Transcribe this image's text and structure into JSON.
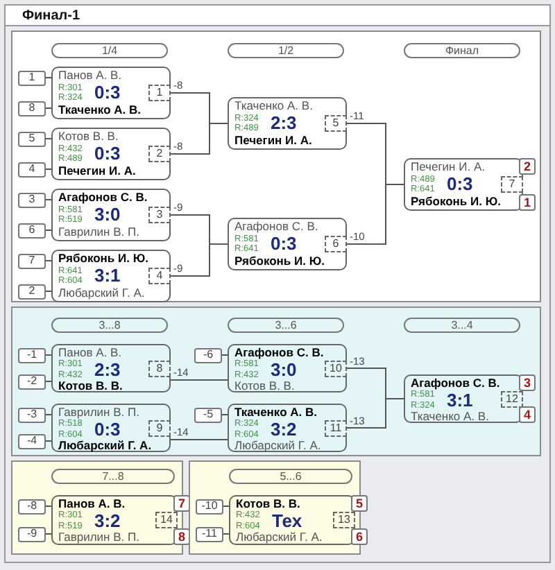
{
  "window": {
    "title": "Финал-1"
  },
  "sections": [
    {
      "kind": "bracket8",
      "rounds": [
        "1/4",
        "1/2",
        "Финал"
      ],
      "matches": [
        {
          "number": "1",
          "score": "0:3",
          "loser_to": "-8",
          "players": [
            {
              "name": "Панов А. В.",
              "rating": "R:301",
              "winner": false,
              "seed": "1"
            },
            {
              "name": "Ткаченко А. В.",
              "rating": "R:324",
              "winner": true,
              "seed": "8"
            }
          ]
        },
        {
          "number": "2",
          "score": "0:3",
          "loser_to": "-8",
          "players": [
            {
              "name": "Котов В. В.",
              "rating": "R:432",
              "winner": false,
              "seed": "5"
            },
            {
              "name": "Печегин И. А.",
              "rating": "R:489",
              "winner": true,
              "seed": "4"
            }
          ]
        },
        {
          "number": "3",
          "score": "3:0",
          "loser_to": "-9",
          "players": [
            {
              "name": "Агафонов С. В.",
              "rating": "R:581",
              "winner": true,
              "seed": "3"
            },
            {
              "name": "Гаврилин В. П.",
              "rating": "R:519",
              "winner": false,
              "seed": "6"
            }
          ]
        },
        {
          "number": "4",
          "score": "3:1",
          "loser_to": "-9",
          "players": [
            {
              "name": "Рябоконь И. Ю.",
              "rating": "R:641",
              "winner": true,
              "seed": "7"
            },
            {
              "name": "Любарский Г. А.",
              "rating": "R:604",
              "winner": false,
              "seed": "2"
            }
          ]
        },
        {
          "number": "5",
          "score": "2:3",
          "loser_to": "-11",
          "players": [
            {
              "name": "Ткаченко А. В.",
              "rating": "R:324",
              "winner": false
            },
            {
              "name": "Печегин И. А.",
              "rating": "R:489",
              "winner": true
            }
          ]
        },
        {
          "number": "6",
          "score": "0:3",
          "loser_to": "-10",
          "players": [
            {
              "name": "Агафонов С. В.",
              "rating": "R:581",
              "winner": false
            },
            {
              "name": "Рябоконь И. Ю.",
              "rating": "R:641",
              "winner": true
            }
          ]
        },
        {
          "number": "7",
          "score": "0:3",
          "players": [
            {
              "name": "Печегин И. А.",
              "rating": "R:489",
              "winner": false,
              "place": "2"
            },
            {
              "name": "Рябоконь И. Ю.",
              "rating": "R:641",
              "winner": true,
              "place": "1"
            }
          ]
        }
      ]
    },
    {
      "kind": "bracket4",
      "rounds": [
        "3...8",
        "3...6",
        "3...4"
      ],
      "matches": [
        {
          "number": "8",
          "score": "2:3",
          "loser_to": "-14",
          "players": [
            {
              "name": "Панов А. В.",
              "rating": "R:301",
              "winner": false,
              "seed": "-1"
            },
            {
              "name": "Котов В. В.",
              "rating": "R:432",
              "winner": true,
              "seed": "-2"
            }
          ]
        },
        {
          "number": "9",
          "score": "0:3",
          "loser_to": "-14",
          "players": [
            {
              "name": "Гаврилин В. П.",
              "rating": "R:518",
              "winner": false,
              "seed": "-3"
            },
            {
              "name": "Любарский Г. А.",
              "rating": "R:604",
              "winner": true,
              "seed": "-4"
            }
          ]
        },
        {
          "number": "10",
          "score": "3:0",
          "loser_to": "-13",
          "players": [
            {
              "name": "Агафонов С. В.",
              "rating": "R:581",
              "winner": true,
              "seed": "-6"
            },
            {
              "name": "Котов В. В.",
              "rating": "R:432",
              "winner": false
            }
          ]
        },
        {
          "number": "11",
          "score": "3:2",
          "loser_to": "-13",
          "players": [
            {
              "name": "Ткаченко А. В.",
              "rating": "R:324",
              "winner": true,
              "seed": "-5"
            },
            {
              "name": "Любарский Г. А.",
              "rating": "R:604",
              "winner": false
            }
          ]
        },
        {
          "number": "12",
          "score": "3:1",
          "players": [
            {
              "name": "Агафонов С. В.",
              "rating": "R:581",
              "winner": true,
              "place": "3"
            },
            {
              "name": "Ткаченко А. В.",
              "rating": "R:324",
              "winner": false,
              "place": "4"
            }
          ]
        }
      ]
    },
    {
      "kind": "single",
      "rounds": [
        "7...8"
      ],
      "matches": [
        {
          "number": "14",
          "score": "3:2",
          "players": [
            {
              "name": "Панов А. В.",
              "rating": "R:301",
              "winner": true,
              "seed": "-8",
              "place": "7"
            },
            {
              "name": "Гаврилин В. П.",
              "rating": "R:519",
              "winner": false,
              "seed": "-9",
              "place": "8"
            }
          ]
        }
      ]
    },
    {
      "kind": "single",
      "rounds": [
        "5...6"
      ],
      "matches": [
        {
          "number": "13",
          "score": "Тех",
          "players": [
            {
              "name": "Котов В. В.",
              "rating": "R:432",
              "winner": true,
              "seed": "-10",
              "place": "5"
            },
            {
              "name": "Любарский Г. А.",
              "rating": "R:604",
              "winner": false,
              "seed": "-11",
              "place": "6"
            }
          ]
        }
      ]
    }
  ]
}
